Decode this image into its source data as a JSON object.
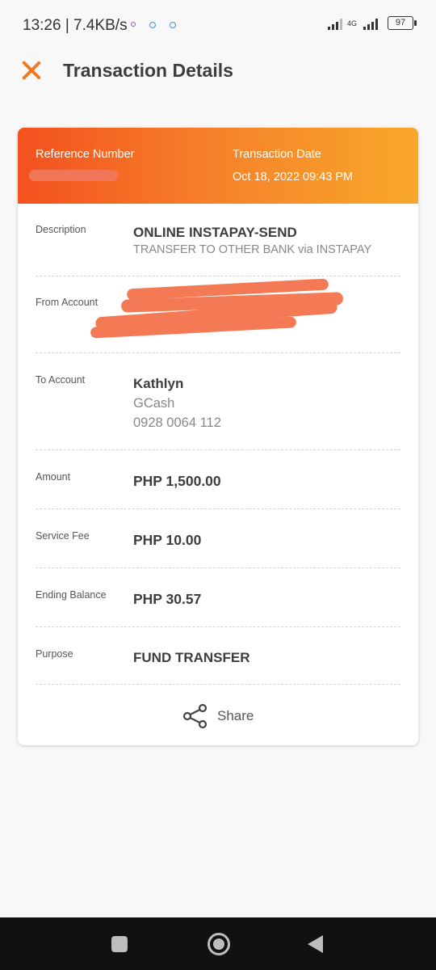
{
  "status_bar": {
    "time_speed": "13:26 | 7.4KB/s",
    "network": "4G",
    "battery": "97"
  },
  "header": {
    "title": "Transaction Details",
    "close_icon": "close-icon",
    "accent_color": "#f07a1f"
  },
  "card": {
    "gradient_colors": [
      "#f4511e",
      "#f8a82a"
    ],
    "reference_label": "Reference Number",
    "reference_value": "",
    "date_label": "Transaction Date",
    "date_value": "Oct 18, 2022 09:43 PM",
    "description": {
      "label": "Description",
      "value": "ONLINE INSTAPAY-SEND",
      "sub": "TRANSFER TO OTHER BANK via INSTAPAY"
    },
    "from_account": {
      "label": "From Account",
      "value": ""
    },
    "to_account": {
      "label": "To Account",
      "name": "Kathlyn",
      "wallet": "GCash",
      "number": "0928 0064 112"
    },
    "amount": {
      "label": "Amount",
      "value": "PHP 1,500.00"
    },
    "service_fee": {
      "label": "Service Fee",
      "value": "PHP 10.00"
    },
    "ending_balance": {
      "label": "Ending Balance",
      "value": "PHP 30.57"
    },
    "purpose": {
      "label": "Purpose",
      "value": "FUND TRANSFER"
    },
    "share_label": "Share",
    "share_icon": "share-icon"
  },
  "nav_bar": {
    "recents_icon": "square-icon",
    "home_icon": "circle-icon",
    "back_icon": "triangle-back-icon"
  }
}
